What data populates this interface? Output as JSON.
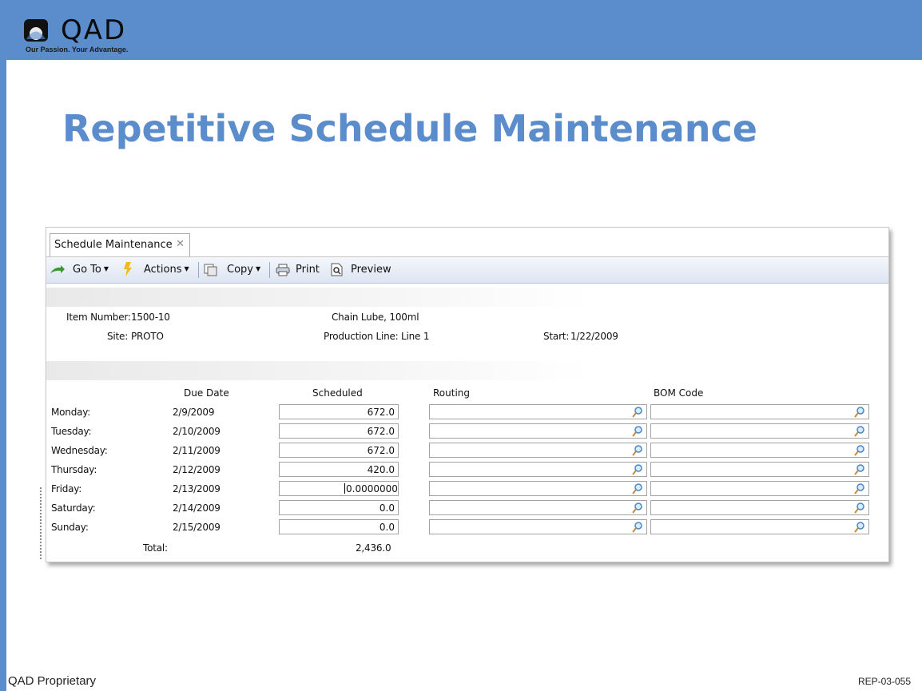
{
  "slide": {
    "logo_text": "QAD",
    "logo_tagline": "Our Passion. Your Advantage.",
    "title": "Repetitive Schedule Maintenance",
    "footer_left": "QAD Proprietary",
    "footer_right": "REP-03-055",
    "brand_color": "#5b8ccc"
  },
  "window": {
    "tab_label": "Schedule Maintenance",
    "tab_close_icon": "close-icon",
    "toolbar": {
      "goto_label": "Go To",
      "actions_label": "Actions",
      "copy_label": "Copy",
      "print_label": "Print",
      "preview_label": "Preview"
    },
    "header": {
      "item_number_label": "Item Number:",
      "item_number_value": "1500-10",
      "item_description": "Chain Lube, 100ml",
      "site_label": "Site:",
      "site_value": "PROTO",
      "production_line_label": "Production Line:",
      "production_line_value": "Line 1",
      "start_label": "Start:",
      "start_value": "1/22/2009"
    },
    "grid": {
      "columns": [
        "Due Date",
        "Scheduled",
        "Routing",
        "BOM Code"
      ],
      "rows": [
        {
          "day": "Monday:",
          "due_date": "2/9/2009",
          "scheduled": "672.0",
          "routing": "",
          "bom_code": ""
        },
        {
          "day": "Tuesday:",
          "due_date": "2/10/2009",
          "scheduled": "672.0",
          "routing": "",
          "bom_code": ""
        },
        {
          "day": "Wednesday:",
          "due_date": "2/11/2009",
          "scheduled": "672.0",
          "routing": "",
          "bom_code": ""
        },
        {
          "day": "Thursday:",
          "due_date": "2/12/2009",
          "scheduled": "420.0",
          "routing": "",
          "bom_code": ""
        },
        {
          "day": "Friday:",
          "due_date": "2/13/2009",
          "scheduled": "0.0000000",
          "routing": "",
          "bom_code": ""
        },
        {
          "day": "Saturday:",
          "due_date": "2/14/2009",
          "scheduled": "0.0",
          "routing": "",
          "bom_code": ""
        },
        {
          "day": "Sunday:",
          "due_date": "2/15/2009",
          "scheduled": "0.0",
          "routing": "",
          "bom_code": ""
        }
      ],
      "total_label": "Total:",
      "total_value": "2,436.0",
      "lookup_icon": "magnifier-icon"
    }
  }
}
